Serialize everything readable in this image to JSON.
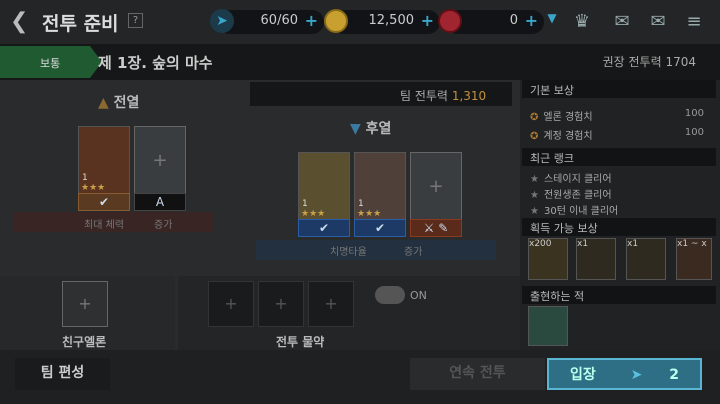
{
  "header": {
    "title": "전투 준비",
    "help": "?",
    "resources": [
      {
        "name": "energy",
        "value": "60/60",
        "icon": "paper-plane-icon",
        "color": "#3aa6c9"
      },
      {
        "name": "gold",
        "value": "12,500",
        "icon": "gold-coin-icon",
        "color": "#c8a030"
      },
      {
        "name": "gem",
        "value": "0",
        "icon": "ruby-icon",
        "color": "#c0303a"
      }
    ],
    "icons": [
      "dropdown-icon",
      "rank-emblem-icon",
      "chat-icon",
      "mail-icon",
      "menu-icon"
    ]
  },
  "stage": {
    "difficulty": "보통",
    "name": "제 1장. 숲의 마수",
    "recommended_label": "권장 전투력",
    "recommended_value": "1704"
  },
  "formation": {
    "front_label": "전열",
    "back_label": "후열",
    "team_power_label": "팀 전투력",
    "team_power_value": "1,310",
    "front_slots": [
      {
        "level": "1",
        "stars": 3,
        "caption": "최대 체력",
        "selected": true
      },
      {
        "level": "",
        "grade": "A",
        "caption": "증가",
        "selected": false
      }
    ],
    "back_slots": [
      {
        "level": "1",
        "stars": 3,
        "caption": "",
        "selected": true
      },
      {
        "level": "1",
        "stars": 3,
        "caption": "치명타율",
        "selected": true
      },
      {
        "level": "",
        "caption": "증가",
        "selected": false
      }
    ]
  },
  "friend": {
    "label": "친구엘론"
  },
  "potions": {
    "label": "전투 물약",
    "toggle": "ON"
  },
  "rewards": {
    "basic_label": "기본 보상",
    "basic": [
      {
        "label": "엘론 경험치",
        "value": "100"
      },
      {
        "label": "계정 경험치",
        "value": "100"
      }
    ],
    "rank_label": "최근 랭크",
    "rank": [
      "스테이지 클리어",
      "전원생존 클리어",
      "30턴 이내 클리어"
    ],
    "obtainable_label": "획득 가능 보상",
    "obtainable": [
      "x200",
      "x1",
      "x1",
      "x1 ~ x"
    ],
    "enemies_label": "출현하는 적"
  },
  "buttons": {
    "team_edit": "팀 편성",
    "repeat": "연속 전투",
    "enter": "입장",
    "enter_cost": "2"
  }
}
